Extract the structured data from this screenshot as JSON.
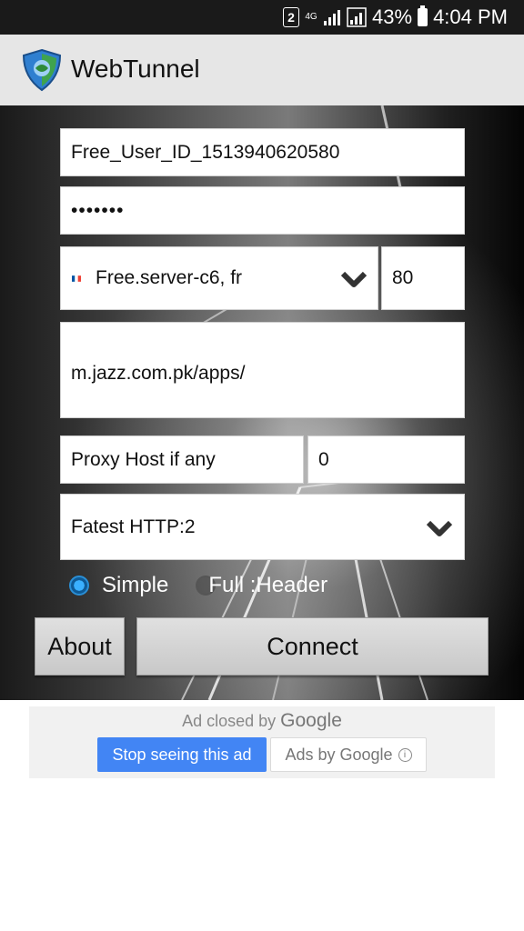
{
  "status_bar": {
    "sim": "2",
    "network": "4G",
    "battery": "43%",
    "time": "4:04 PM"
  },
  "app": {
    "title": "WebTunnel"
  },
  "form": {
    "user_id": "Free_User_ID_1513940620580",
    "password": "•••••••",
    "server": {
      "flag": "fr",
      "value": "Free.server-c6, fr"
    },
    "port": "80",
    "host": "m.jazz.com.pk/apps/",
    "proxy_host_placeholder": "Proxy Host if any",
    "proxy_port": "0",
    "method": "Fatest HTTP:2",
    "mode_simple": "Simple",
    "mode_full": "Full :Header",
    "selected_mode": "Simple"
  },
  "buttons": {
    "about": "About",
    "connect": "Connect"
  },
  "ad": {
    "closed_text": "Ad closed by",
    "brand": "Google",
    "stop": "Stop seeing this ad",
    "ads_by": "Ads by Google"
  },
  "colors": {
    "accent": "#4285f4",
    "radio": "#2a8fd6",
    "status_bar": "#1a1a1a",
    "app_bar": "#e6e6e6"
  }
}
